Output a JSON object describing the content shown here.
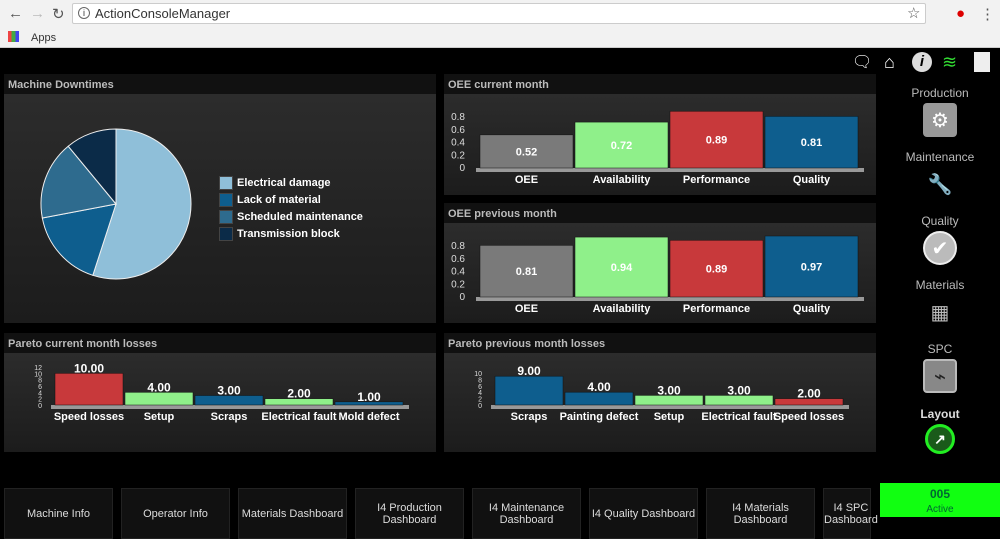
{
  "browser": {
    "url": "ActionConsoleManager",
    "bookmark": "Apps"
  },
  "colors": {
    "red": "#c8393b",
    "green": "#8ff08a",
    "blue": "#0e5e8e",
    "gray": "#7a7a7a"
  },
  "downtimes": {
    "title": "Machine Downtimes",
    "chart_data": {
      "type": "pie",
      "slices": [
        {
          "label": "Electrical damage",
          "value": 55,
          "color": "#8fbfd9"
        },
        {
          "label": "Lack of material",
          "value": 17,
          "color": "#0e5e8e"
        },
        {
          "label": "Scheduled maintenance",
          "value": 17,
          "color": "#2e6b8e"
        },
        {
          "label": "Transmission block",
          "value": 11,
          "color": "#0b2b48"
        }
      ],
      "legend": "right"
    }
  },
  "oee_current": {
    "title": "OEE current month",
    "chart_data": {
      "type": "bar",
      "categories": [
        "OEE",
        "Availability",
        "Performance",
        "Quality"
      ],
      "values": [
        0.52,
        0.72,
        0.89,
        0.81
      ],
      "labels": [
        "0.52",
        "0.72",
        "0.89",
        "0.81"
      ],
      "colors": [
        "#7a7a7a",
        "#8ff08a",
        "#c8393b",
        "#0e5e8e"
      ],
      "yticks": [
        "0.8",
        "0.6",
        "0.4",
        "0.2",
        "0"
      ],
      "ylim": [
        0,
        0.8
      ]
    }
  },
  "oee_previous": {
    "title": "OEE previous month",
    "chart_data": {
      "type": "bar",
      "categories": [
        "OEE",
        "Availability",
        "Performance",
        "Quality"
      ],
      "values": [
        0.81,
        0.94,
        0.89,
        0.97
      ],
      "labels": [
        "0.81",
        "0.94",
        "0.89",
        "0.97"
      ],
      "colors": [
        "#7a7a7a",
        "#8ff08a",
        "#c8393b",
        "#0e5e8e"
      ],
      "yticks": [
        "0.8",
        "0.6",
        "0.4",
        "0.2",
        "0"
      ],
      "ylim": [
        0,
        0.8
      ]
    }
  },
  "pareto_current": {
    "title": "Pareto current month losses",
    "chart_data": {
      "type": "bar",
      "categories": [
        "Speed losses",
        "Setup",
        "Scraps",
        "Electrical fault",
        "Mold defect"
      ],
      "values": [
        10,
        4,
        3,
        2,
        1
      ],
      "labels": [
        "10.00",
        "4.00",
        "3.00",
        "2.00",
        "1.00"
      ],
      "colors": [
        "#c8393b",
        "#8ff08a",
        "#0e5e8e",
        "#8ff08a",
        "#0e5e8e"
      ],
      "yticks": [
        "12",
        "10",
        "8",
        "6",
        "4",
        "2",
        "0"
      ],
      "ylim": [
        0,
        12
      ]
    }
  },
  "pareto_previous": {
    "title": "Pareto previous month losses",
    "chart_data": {
      "type": "bar",
      "categories": [
        "Scraps",
        "Painting defect",
        "Setup",
        "Electrical fault",
        "Speed losses"
      ],
      "values": [
        9,
        4,
        3,
        3,
        2
      ],
      "labels": [
        "9.00",
        "4.00",
        "3.00",
        "3.00",
        "2.00"
      ],
      "colors": [
        "#0e5e8e",
        "#0e5e8e",
        "#8ff08a",
        "#8ff08a",
        "#c8393b"
      ],
      "yticks": [
        "10",
        "8",
        "6",
        "4",
        "2",
        "0"
      ],
      "ylim": [
        0,
        10
      ]
    }
  },
  "sidebar": {
    "items": [
      {
        "label": "Production",
        "icon": "gear-icon"
      },
      {
        "label": "Maintenance",
        "icon": "wrench-icon"
      },
      {
        "label": "Quality",
        "icon": "check-icon"
      },
      {
        "label": "Materials",
        "icon": "boxes-icon"
      },
      {
        "label": "SPC",
        "icon": "chip-icon"
      },
      {
        "label": "Layout",
        "icon": "gauge-icon"
      }
    ]
  },
  "tabs": [
    "Machine Info",
    "Operator Info",
    "Materials Dashboard",
    "I4 Production Dashboard",
    "I4 Maintenance Dashboard",
    "I4 Quality Dashboard",
    "I4 Materials Dashboard",
    "I4 SPC Dashboard"
  ],
  "status": {
    "code": "005",
    "state": "Active"
  }
}
